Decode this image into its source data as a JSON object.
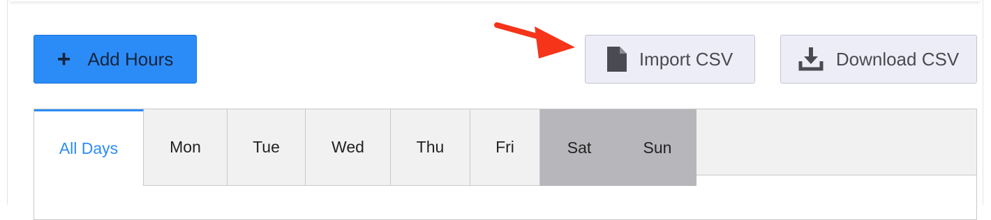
{
  "toolbar": {
    "add_hours_label": "Add Hours",
    "import_csv_label": "Import CSV",
    "download_csv_label": "Download CSV"
  },
  "icons": {
    "add": "plus-icon",
    "import": "document-icon",
    "download": "download-icon",
    "annotation": "red-arrow"
  },
  "colors": {
    "primary": "#2b8cf8",
    "arrow": "#f5341a",
    "weekend_tab": "#b6b6bb"
  },
  "day_tabs": [
    {
      "label": "All Days",
      "active": true
    },
    {
      "label": "Mon"
    },
    {
      "label": "Tue"
    },
    {
      "label": "Wed"
    },
    {
      "label": "Thu"
    },
    {
      "label": "Fri"
    },
    {
      "label": "Sat",
      "weekend": true
    },
    {
      "label": "Sun",
      "weekend": true
    }
  ]
}
